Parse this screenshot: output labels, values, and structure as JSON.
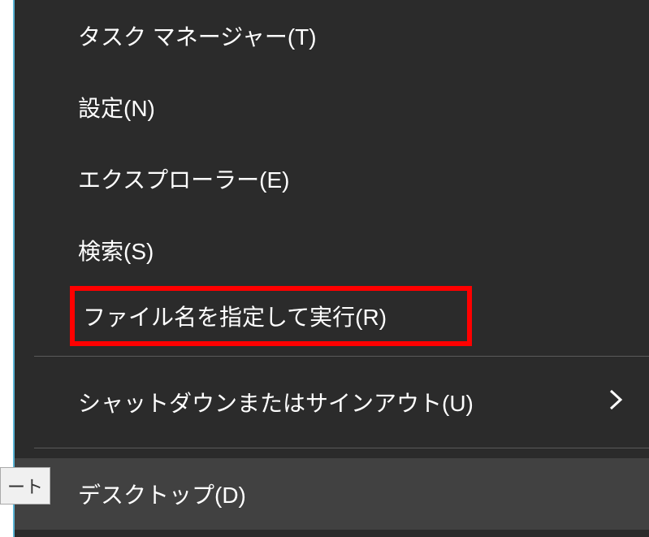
{
  "menu": {
    "items": [
      {
        "label": "タスク マネージャー(T)",
        "hasSubmenu": false
      },
      {
        "label": "設定(N)",
        "hasSubmenu": false
      },
      {
        "label": "エクスプローラー(E)",
        "hasSubmenu": false
      },
      {
        "label": "検索(S)",
        "hasSubmenu": false
      },
      {
        "label": "ファイル名を指定して実行(R)",
        "hasSubmenu": false,
        "highlighted": true
      },
      {
        "label": "シャットダウンまたはサインアウト(U)",
        "hasSubmenu": true
      },
      {
        "label": "デスクトップ(D)",
        "hasSubmenu": false,
        "hovered": true
      }
    ]
  },
  "tooltip": {
    "fragment": "ート"
  }
}
